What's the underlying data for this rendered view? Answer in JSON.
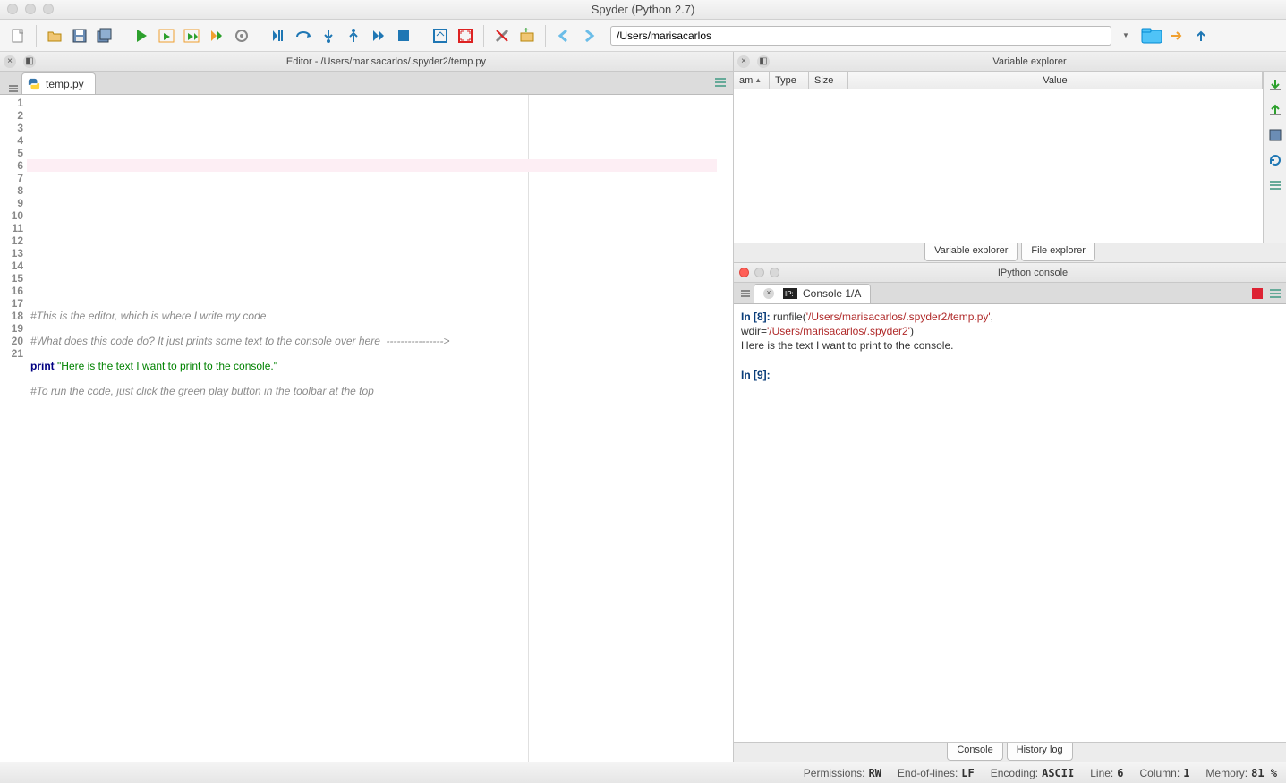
{
  "window": {
    "title": "Spyder (Python 2.7)"
  },
  "toolbar": {
    "path": "/Users/marisacarlos"
  },
  "editor": {
    "pane_title": "Editor - /Users/marisacarlos/.spyder2/temp.py",
    "tab_label": "temp.py",
    "active_line": 6,
    "lines": [
      "",
      "",
      "",
      "",
      "",
      "",
      "",
      "",
      "",
      "",
      "",
      "",
      "",
      "",
      "#This is the editor, which is where I write my code",
      "",
      "#What does this code do? It just prints some text to the console over here  ---------------->",
      "",
      "",
      "",
      "#To run the code, just click the green play button in the toolbar at the top"
    ],
    "print_kw": "print",
    "print_str": "\"Here is the text I want to print to the console.\""
  },
  "varex": {
    "title": "Variable explorer",
    "cols": {
      "name": "am",
      "type": "Type",
      "size": "Size",
      "value": "Value"
    },
    "tabs": {
      "var": "Variable explorer",
      "file": "File explorer"
    }
  },
  "ipython": {
    "title": "IPython console",
    "tab_label": "Console 1/A",
    "in8": "In [8]:",
    "runfile_pre": " runfile(",
    "runfile_path": "'/Users/marisacarlos/.spyder2/temp.py'",
    "runfile_mid": ", \nwdir=",
    "runfile_wdir": "'/Users/marisacarlos/.spyder2'",
    "runfile_post": ")",
    "output": "Here is the text I want to print to the console.",
    "in9": "In [9]:",
    "tabs": {
      "console": "Console",
      "history": "History log"
    }
  },
  "status": {
    "perm_l": "Permissions:",
    "perm_v": "RW",
    "eol_l": "End-of-lines:",
    "eol_v": "LF",
    "enc_l": "Encoding:",
    "enc_v": "ASCII",
    "line_l": "Line:",
    "line_v": "6",
    "col_l": "Column:",
    "col_v": "1",
    "mem_l": "Memory:",
    "mem_v": "81 %"
  }
}
